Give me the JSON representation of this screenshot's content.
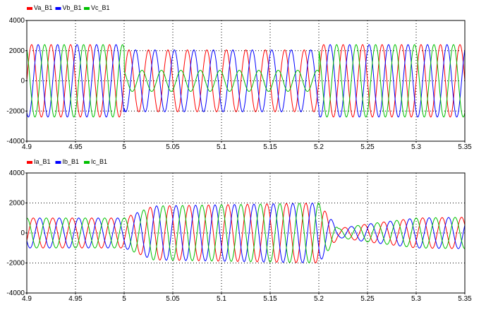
{
  "chart_data": [
    {
      "type": "line",
      "title": "",
      "xlabel": "",
      "ylabel": "",
      "xlim": [
        4.9,
        5.35
      ],
      "ylim": [
        -4000,
        4000
      ],
      "x_ticks": [
        "4.9",
        "4.95",
        "5",
        "5.05",
        "5.1",
        "5.15",
        "5.2",
        "5.25",
        "5.3",
        "5.35"
      ],
      "y_ticks": [
        "4000",
        "2000",
        "0",
        "-2000",
        "-4000"
      ],
      "grid": true,
      "legend_position": "top-left",
      "frequency_hz": 50,
      "series": [
        {
          "name": "Va_B1",
          "color": "#ff0000",
          "phase_deg": 0,
          "x": [
            4.9,
            5.0,
            5.0,
            5.2,
            5.2,
            5.35
          ],
          "amplitude": [
            2400,
            2400,
            2050,
            2050,
            2400,
            2400
          ]
        },
        {
          "name": "Vb_B1",
          "color": "#0000ff",
          "phase_deg": -120,
          "x": [
            4.9,
            5.0,
            5.0,
            5.2,
            5.2,
            5.35
          ],
          "amplitude": [
            2400,
            2400,
            2050,
            2050,
            2400,
            2400
          ]
        },
        {
          "name": "Vc_B1",
          "color": "#00c000",
          "phase_deg": 120,
          "x": [
            4.9,
            5.0,
            5.0,
            5.2,
            5.2,
            5.35
          ],
          "amplitude": [
            2400,
            2400,
            700,
            700,
            2400,
            2400
          ]
        }
      ]
    },
    {
      "type": "line",
      "title": "",
      "xlabel": "",
      "ylabel": "",
      "xlim": [
        4.9,
        5.35
      ],
      "ylim": [
        -4000,
        4000
      ],
      "x_ticks": [
        "4.9",
        "4.95",
        "5",
        "5.05",
        "5.1",
        "5.15",
        "5.2",
        "5.25",
        "5.3",
        "5.35"
      ],
      "y_ticks": [
        "4000",
        "2000",
        "0",
        "-2000",
        "-4000"
      ],
      "grid": true,
      "legend_position": "top-left",
      "frequency_hz": 50,
      "series": [
        {
          "name": "Ia_B1",
          "color": "#ff0000",
          "phase_deg": -30,
          "x": [
            4.9,
            5.0,
            5.03,
            5.2,
            5.22,
            5.25,
            5.3,
            5.35
          ],
          "amplitude": [
            1000,
            1000,
            1800,
            2000,
            300,
            600,
            1000,
            1050
          ]
        },
        {
          "name": "Ib_B1",
          "color": "#0000ff",
          "phase_deg": -150,
          "x": [
            4.9,
            5.0,
            5.03,
            5.2,
            5.22,
            5.25,
            5.3,
            5.35
          ],
          "amplitude": [
            1000,
            1000,
            1800,
            2000,
            300,
            600,
            1000,
            1050
          ]
        },
        {
          "name": "Ic_B1",
          "color": "#00c000",
          "phase_deg": 90,
          "x": [
            4.9,
            5.0,
            5.03,
            5.2,
            5.22,
            5.25,
            5.3,
            5.35
          ],
          "amplitude": [
            1000,
            1000,
            1800,
            2000,
            300,
            600,
            1000,
            1050
          ]
        }
      ]
    }
  ]
}
